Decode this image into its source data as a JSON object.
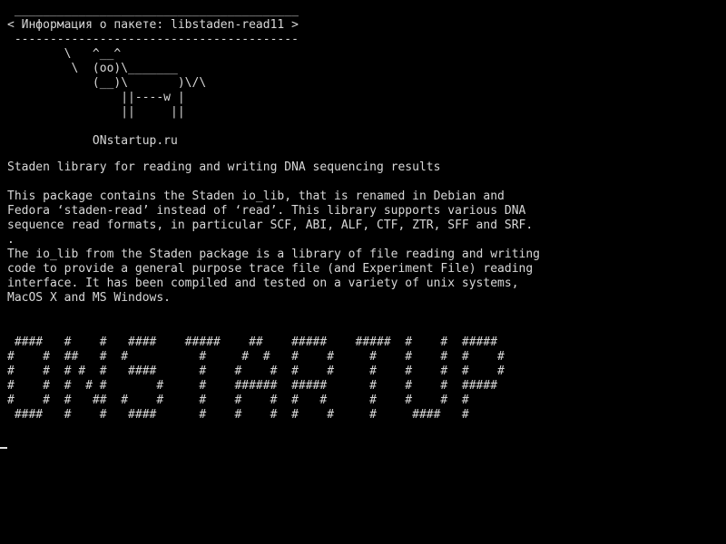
{
  "terminal": {
    "cowsay": [
      " ________________________________________",
      "< Информация о пакете: libstaden-read11 >",
      " ----------------------------------------",
      "        \\   ^__^",
      "         \\  (oo)\\_______",
      "            (__)\\       )\\/\\",
      "                ||----w |",
      "                ||     ||",
      "",
      "            ONstartup.ru"
    ],
    "summary": "Staden library for reading and writing DNA sequencing results",
    "description": [
      "This package contains the Staden io_lib, that is renamed in Debian and",
      "Fedora ‘staden-read’ instead of ‘read’. This library supports various DNA",
      "sequence read formats, in particular SCF, ABI, ALF, CTF, ZTR, SFF and SRF.",
      ".",
      "The io_lib from the Staden package is a library of file reading and writing",
      "code to provide a general purpose trace file (and Experiment File) reading",
      "interface. It has been compiled and tested on a variety of unix systems,",
      "MacOS X and MS Windows."
    ],
    "banner": [
      " ####   #    #   ####    #####    ##    #####    #####  #    #  #####",
      "#    #  ##   #  #          #     #  #   #    #     #    #    #  #    #",
      "#    #  # #  #   ####      #    #    #  #    #     #    #    #  #    #",
      "#    #  #  # #       #     #    ######  #####      #    #    #  #####",
      "#    #  #   ##  #    #     #    #    #  #   #      #    #    #  #",
      " ####   #    #   ####      #    #    #  #    #     #     ####   #"
    ]
  }
}
